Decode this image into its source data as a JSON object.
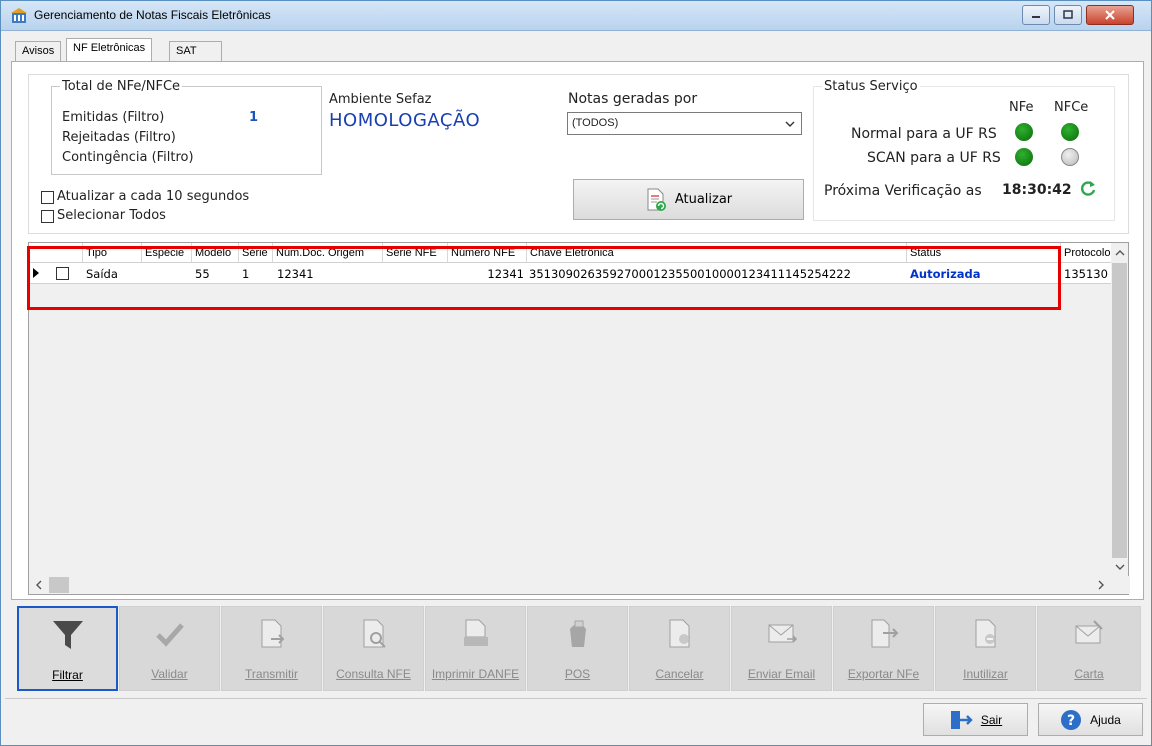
{
  "window": {
    "title": "Gerenciamento de Notas Fiscais Eletrônicas",
    "minimize_icon": "minimize-icon",
    "maximize_icon": "maximize-icon",
    "close_icon": "close-icon"
  },
  "tabs": [
    {
      "label": "Avisos"
    },
    {
      "label": "NF Eletrônicas"
    },
    {
      "label": "SAT"
    }
  ],
  "totals": {
    "legend": "Total de NFe/NFCe",
    "emitidas_label": "Emitidas (Filtro)",
    "emitidas_value": "1",
    "rejeitadas_label": "Rejeitadas (Filtro)",
    "contingencia_label": "Contingência (Filtro)"
  },
  "ambiente": {
    "label": "Ambiente Sefaz",
    "value": "HOMOLOGAÇÃO"
  },
  "notas": {
    "label": "Notas geradas por",
    "selected": "(TODOS)"
  },
  "options": {
    "auto_refresh": "Atualizar a cada 10 segundos",
    "select_all": "Selecionar Todos"
  },
  "update_button": "Atualizar",
  "status": {
    "legend": "Status Serviço",
    "col_nfe": "NFe",
    "col_nfce": "NFCe",
    "row1": "Normal para a UF RS",
    "row2": "SCAN para a UF RS",
    "next_check_label": "Próxima Verificação as",
    "next_check_time": "18:30:42",
    "colors": {
      "green": "#0d8a0d",
      "gray": "#c8c8c8"
    }
  },
  "grid": {
    "headers": [
      "Tipo",
      "Espécie",
      "Modelo",
      "Série",
      "Núm.Doc. Origem",
      "Série NFE",
      "Número NFE",
      "Chave Eletrônica",
      "Status",
      "Protocolo"
    ],
    "row": {
      "tipo": "Saída",
      "especie": "",
      "modelo": "55",
      "serie": "1",
      "num_doc": "12341",
      "serie_nfe": "",
      "numero_nfe": "12341",
      "chave": "35130902635927000123550010000123411145254222",
      "status": "Autorizada",
      "protocolo": "135130"
    },
    "status_color": "#0033cc"
  },
  "toolbar": [
    {
      "label": "Filtrar",
      "icon": "filter-icon"
    },
    {
      "label": "Validar",
      "icon": "check-icon"
    },
    {
      "label": "Transmitir",
      "icon": "transmit-icon"
    },
    {
      "label": "Consulta NFE",
      "icon": "search-document-icon"
    },
    {
      "label": "Imprimir DANFE",
      "icon": "print-icon"
    },
    {
      "label": "POS",
      "icon": "pos-icon"
    },
    {
      "label": "Cancelar",
      "icon": "cancel-document-icon"
    },
    {
      "label": "Enviar Email",
      "icon": "email-icon"
    },
    {
      "label": "Exportar NFe",
      "icon": "export-icon"
    },
    {
      "label": "Inutilizar",
      "icon": "disable-icon"
    },
    {
      "label": "Carta",
      "icon": "letter-icon"
    }
  ],
  "footer": {
    "sair": "Sair",
    "ajuda": "Ajuda"
  }
}
